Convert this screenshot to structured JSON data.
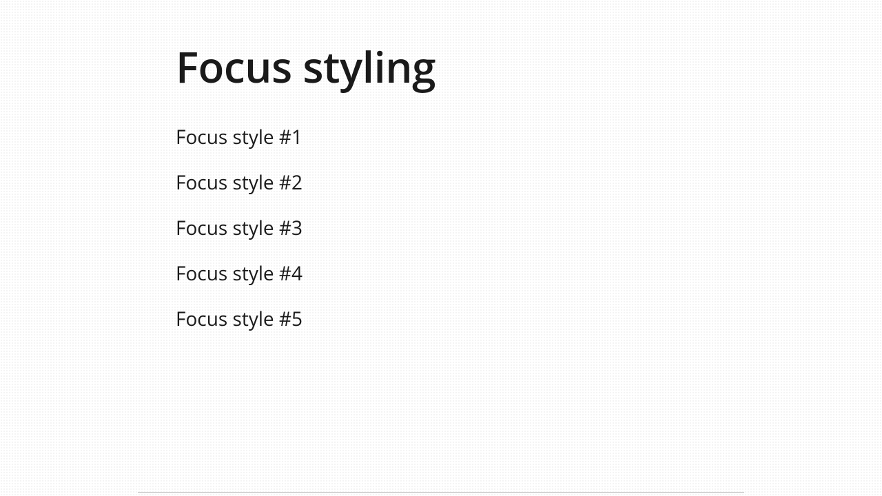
{
  "heading": "Focus styling",
  "items": [
    {
      "label": "Focus style #1"
    },
    {
      "label": "Focus style #2"
    },
    {
      "label": "Focus style #3"
    },
    {
      "label": "Focus style #4"
    },
    {
      "label": "Focus style #5"
    }
  ]
}
